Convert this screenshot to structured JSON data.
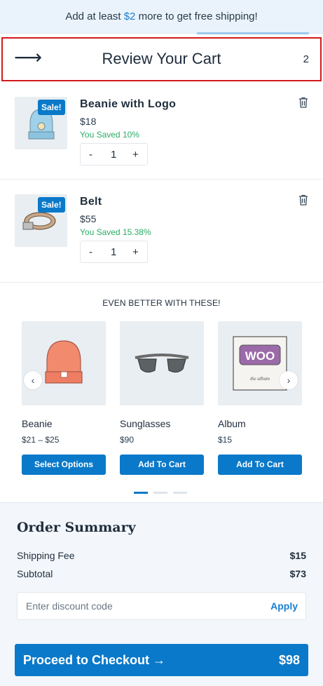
{
  "shipping_bar": {
    "prefix": "Add at least ",
    "amount": "$2",
    "suffix": " more to get free shipping!"
  },
  "header": {
    "back_icon": "arrow-right-icon",
    "title": "Review Your Cart",
    "count": "2"
  },
  "cart_items": [
    {
      "name": "Beanie with Logo",
      "price": "$18",
      "saved": "You Saved 10%",
      "badge": "Sale!",
      "qty": "1",
      "minus": "-",
      "plus": "+"
    },
    {
      "name": "Belt",
      "price": "$55",
      "saved": "You Saved 15.38%",
      "badge": "Sale!",
      "qty": "1",
      "minus": "-",
      "plus": "+"
    }
  ],
  "upsell": {
    "title": "EVEN BETTER WITH THESE!",
    "products": [
      {
        "name": "Beanie",
        "price": "$21 – $25",
        "button": "Select Options"
      },
      {
        "name": "Sunglasses",
        "price": "$90",
        "button": "Add To Cart"
      },
      {
        "name": "Album",
        "price": "$15",
        "button": "Add To Cart",
        "art_text": "WOO",
        "art_sub": "the album"
      }
    ],
    "prev_icon": "‹",
    "next_icon": "›",
    "pages": 3,
    "active_page": 1
  },
  "summary": {
    "title": "Order Summary",
    "shipping_label": "Shipping Fee",
    "shipping_value": "$15",
    "subtotal_label": "Subtotal",
    "subtotal_value": "$73",
    "discount_placeholder": "Enter discount code",
    "apply_label": "Apply"
  },
  "checkout": {
    "label": "Proceed to Checkout →",
    "total": "$98"
  },
  "colors": {
    "accent": "#0a79c9",
    "saved": "#2bab66",
    "highlight_border": "#d11a1a",
    "summary_bg": "#f3f7fb"
  }
}
